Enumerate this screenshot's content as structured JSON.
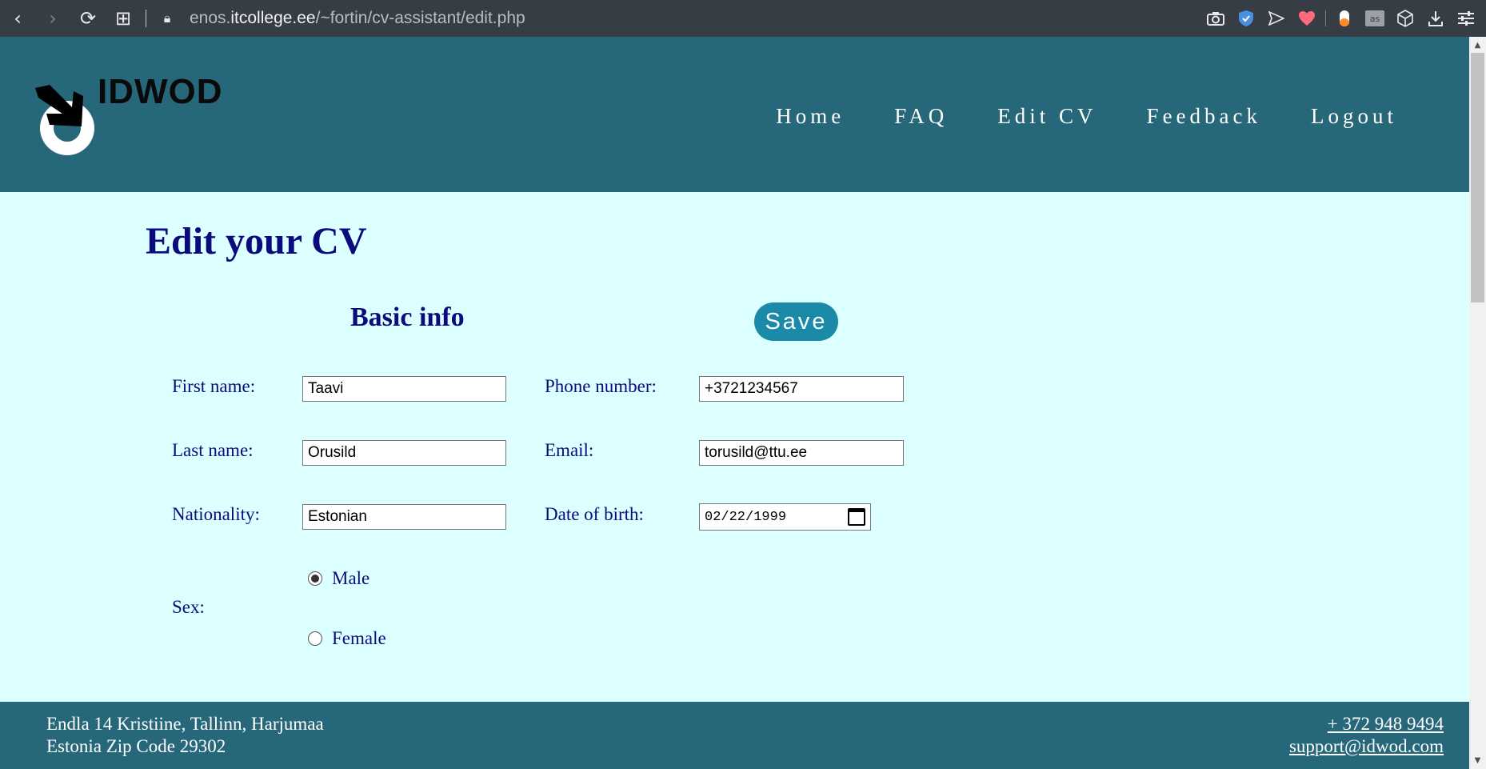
{
  "browser": {
    "url_prefix": "enos.",
    "url_domain": "itcollege.ee",
    "url_path": "/~fortin/cv-assistant/edit.php"
  },
  "site": {
    "logo_text": "IDWOD",
    "nav": [
      "Home",
      "FAQ",
      "Edit CV",
      "Feedback",
      "Logout"
    ]
  },
  "page": {
    "title": "Edit your CV",
    "section_title": "Basic info",
    "save_label": "Save"
  },
  "form": {
    "first_name_label": "First name:",
    "first_name_value": "Taavi",
    "last_name_label": "Last name:",
    "last_name_value": "Orusild",
    "nationality_label": "Nationality:",
    "nationality_value": "Estonian",
    "phone_label": "Phone number:",
    "phone_value": "+3721234567",
    "email_label": "Email:",
    "email_value": "torusild@ttu.ee",
    "dob_label": "Date of birth:",
    "dob_value": "02/22/1999",
    "sex_label": "Sex:",
    "sex_options": [
      "Male",
      "Female"
    ],
    "sex_selected": "Male"
  },
  "footer": {
    "address_line1": "Endla 14 Kristiine, Tallinn, Harjumaa",
    "address_line2": "Estonia Zip Code 29302",
    "phone": "+ 372 948 9494",
    "email": "support@idwod.com"
  },
  "colors": {
    "header_bg": "#266879",
    "page_bg": "#dcffff",
    "heading": "#0b0b7d",
    "save_button": "#1a8aa8"
  }
}
